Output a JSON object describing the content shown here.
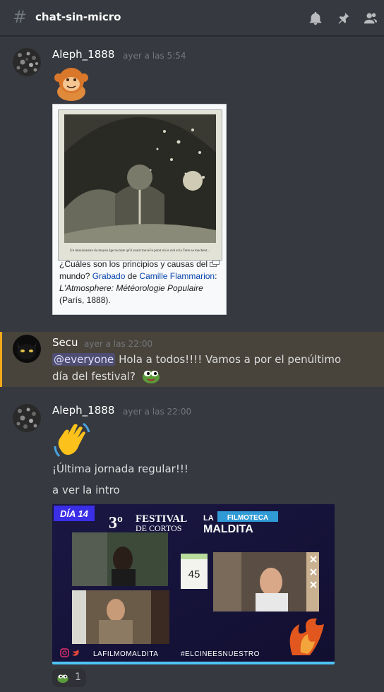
{
  "channel": {
    "name": "chat-sin-micro"
  },
  "messages": [
    {
      "author": "Aleph_1888",
      "time": "ayer a las 5:54",
      "emoji_name": "orangutan-emoji",
      "embed": {
        "image_caption": "Un missionnaire du moyen âge raconte qu'il avait trouvé le point où le ciel et la Terre se touchent...",
        "caption_parts": [
          {
            "text": "¿Cuáles son los principios y causas del mundo? ",
            "style": "plain"
          },
          {
            "text": "Grabado",
            "style": "link"
          },
          {
            "text": " de ",
            "style": "plain"
          },
          {
            "text": "Camille Flammarion",
            "style": "link"
          },
          {
            "text": ": ",
            "style": "plain"
          },
          {
            "text": "L'Atmosphere: Météorologie Populaire",
            "style": "italic"
          },
          {
            "text": " (París, 1888).",
            "style": "plain"
          }
        ]
      }
    },
    {
      "author": "Secu",
      "time": "ayer a las 22:00",
      "mention": "@everyone",
      "text_line1": " Hola a todos!!!! Vamos a por el penúltimo",
      "text_line2": "día del festival?"
    },
    {
      "author": "Aleph_1888",
      "time": "ayer a las 22:00",
      "emoji_name": "waving-hand-emoji",
      "line1": "¡Última jornada regular!!!",
      "line2": "a ver la intro",
      "video": {
        "day_badge": "DÍA 14",
        "festival_number": "3º",
        "festival_title": "FESTIVAL",
        "festival_subtitle": "DE CORTOS",
        "brand_top": "LA",
        "brand_middle": "FILMOTECA",
        "brand_bottom": "MALDITA",
        "counter": "45",
        "handle": "LAFILMOMALDITA",
        "hashtag": "#ELCINEESNUESTRO"
      },
      "reaction_count": "1"
    }
  ],
  "colors": {
    "background": "#36393f",
    "mention_bar": "#faa81a",
    "link": "#0645ad"
  }
}
